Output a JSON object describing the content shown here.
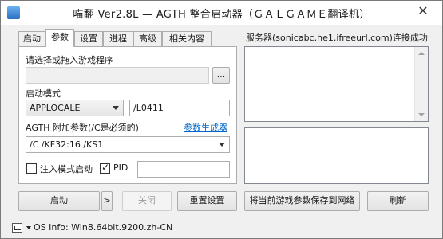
{
  "window": {
    "title": "喵翻 Ver2.8L — AGTH 整合启动器（ＧＡＬＧＡＭＥ翻译机）",
    "close_glyph": "✕"
  },
  "tabs": [
    {
      "label": "启动",
      "active": false
    },
    {
      "label": "参数",
      "active": true
    },
    {
      "label": "设置",
      "active": false
    },
    {
      "label": "进程",
      "active": false
    },
    {
      "label": "高级",
      "active": false
    },
    {
      "label": "相关内容",
      "active": false
    }
  ],
  "params": {
    "game_label": "请选择或拖入游戏程序",
    "game_path": "",
    "browse_label": "...",
    "mode_label": "启动模式",
    "mode_value": "APPLOCALE",
    "locale_value": "/L0411",
    "agth_label": "AGTH 附加参数(/C是必须的)",
    "generator_link": "参数生成器",
    "agth_value": "/C /KF32:16 /KS1",
    "inject_label": "注入模式启动",
    "inject_checked": false,
    "pid_label": "PID",
    "pid_checked": true,
    "pid_value": ""
  },
  "right": {
    "server_status": "服务器(sonicabc.he1.ifreeurl.com)连接成功"
  },
  "buttons": {
    "start": "启动",
    "arrow": ">",
    "close": "关闭",
    "reset": "重置设置",
    "save_network": "将当前游戏参数保存到网络",
    "refresh": "刷新"
  },
  "status": {
    "os_info": "OS Info: Win8.64bit.9200.zh-CN"
  }
}
